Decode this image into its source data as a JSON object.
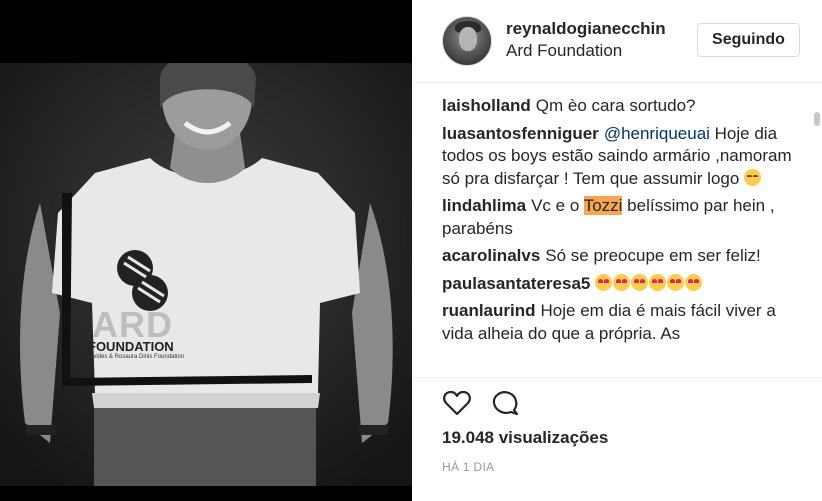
{
  "post": {
    "username": "reynaldogianecchin",
    "location": "Ard Foundation",
    "follow_button": "Seguindo",
    "shirt_text": {
      "logo": "ARD",
      "line": "FOUNDATION",
      "small": "Alvides & Rosaura Dinis Foundation"
    }
  },
  "comments": [
    {
      "user": "laisholland",
      "text": "Qm èo cara sortudo?"
    },
    {
      "user": "luasantosfenniguer",
      "mention": "@henriqueuai",
      "text": " Hoje dia todos os boys estão saindo armário ,namoram só pra disfarçar ! Tem que assumir logo ",
      "emoji_count": 1
    },
    {
      "user": "lindahlima",
      "before": "Vc e o ",
      "highlight": "Tozzi",
      "after": " belíssimo par hein , parabéns"
    },
    {
      "user": "acarolinalvs",
      "text": "Só se preocupe em ser feliz!"
    },
    {
      "user": "paulasantateresa5",
      "text": "",
      "emoji_count": 6
    },
    {
      "user": "ruanlaurind",
      "text": "Hoje em dia é mais fácil viver a vida alheia do que a própria. As"
    }
  ],
  "footer": {
    "views": "19.048 visualizações",
    "time": "HÁ 1 DIA"
  },
  "icons": {
    "like": "heart-icon",
    "comment": "comment-bubble-icon"
  },
  "colors": {
    "text": "#262626",
    "mention": "#003569",
    "highlight": "#f5a64e",
    "muted": "#999999",
    "border": "#dbdbdb"
  }
}
